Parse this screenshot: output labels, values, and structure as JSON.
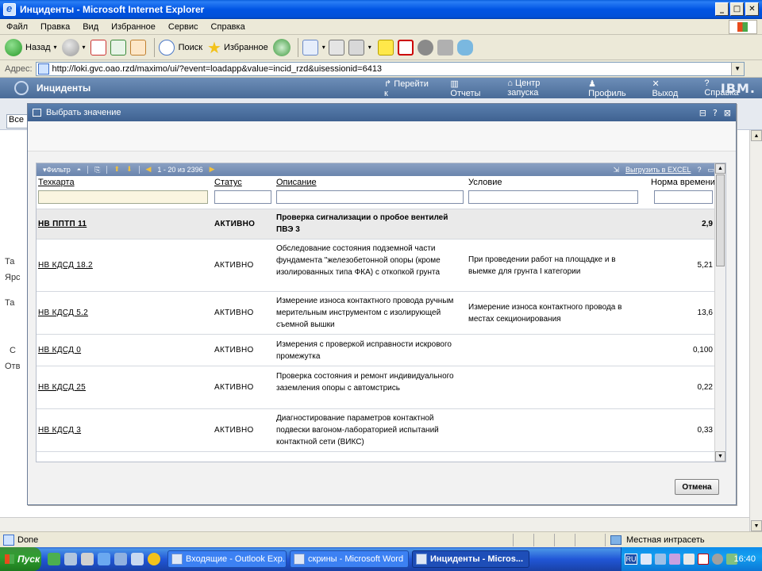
{
  "window": {
    "title": "Инциденты - Microsoft Internet Explorer",
    "minimize": "_",
    "maximize": "□",
    "close": "✕"
  },
  "menu": [
    "Файл",
    "Правка",
    "Вид",
    "Избранное",
    "Сервис",
    "Справка"
  ],
  "toolbar": {
    "back_label": "Назад",
    "search_label": "Поиск",
    "favorites_label": "Избранное"
  },
  "address": {
    "label": "Адрес:",
    "url": "http://loki.gvc.oao.rzd/maximo/ui/?event=loadapp&value=incid_rzd&uisessionid=6413"
  },
  "app": {
    "title": "Инциденты",
    "links": [
      "Перейти к",
      "Отчеты",
      "Центр запуска",
      "Профиль",
      "Выход",
      "Справка"
    ],
    "ibm": "IBM.",
    "bg_input": "Все"
  },
  "background_fragments": [
    "Та",
    "Ярс",
    "Та",
    "С",
    "Отв"
  ],
  "dialog": {
    "title": "Выбрать значение",
    "controls": [
      "⊟",
      "?",
      "⊠"
    ],
    "toolbar": {
      "filter_label": "Фильтр",
      "pagination": "1 - 20 из 2396",
      "export_label": "Выгрузить в EXCEL",
      "help": "?"
    },
    "columns": {
      "code": "Техкарта",
      "status": "Статус",
      "description": "Описание",
      "condition": "Условие",
      "norm": "Норма времени"
    },
    "rows": [
      {
        "code": "НВ ППТП 11",
        "status": "АКТИВНО",
        "description": "Проверка сигнализации о пробое вентилей ПВЭ 3",
        "condition": "",
        "norm": "2,9"
      },
      {
        "code": "НВ КДСД 18.2",
        "status": "АКТИВНО",
        "description": "Обследование состояния подземной части фундамента \"железобетонной опоры (кроме изолированных типа ФКА) с откопкой грунта",
        "condition": "При проведении работ на площадке и в выемке для грунта I категории",
        "norm": "5,21"
      },
      {
        "code": "НВ КДСД 5.2",
        "status": "АКТИВНО",
        "description": "Измерение износа контактного провода ручным мерительным инструментом с изолирующей съемной вышки",
        "condition": "Измерение износа контактного провода в местах секционирования",
        "norm": "13,6"
      },
      {
        "code": "НВ КДСД 0",
        "status": "АКТИВНО",
        "description": "Измерения с проверкой исправности искрового промежутка",
        "condition": "",
        "norm": "0,100"
      },
      {
        "code": "НВ КДСД 25",
        "status": "АКТИВНО",
        "description": "Проверка состояния и ремонт индивидуального заземления опоры с автомстрись",
        "condition": "",
        "norm": "0,22"
      },
      {
        "code": "НВ КДСД 3",
        "status": "АКТИВНО",
        "description": "Диагностирование параметров контактной подвески вагоном-лабораторией испытаний контактной сети (ВИКС)",
        "condition": "",
        "norm": "0,33"
      }
    ],
    "cancel_label": "Отмена"
  },
  "statusbar": {
    "left": "Done",
    "zone": "Местная интрасеть"
  },
  "taskbar": {
    "start": "Пуск",
    "tasks": [
      "Входящие - Outlook Exp...",
      "скрины - Microsoft Word",
      "Инциденты - Micros..."
    ],
    "lang": "RU",
    "clock": "16:40"
  },
  "colors": {
    "titlebar": "#0054e3",
    "app_header": "#4a6c98",
    "dialog_title": "#3f6291"
  }
}
